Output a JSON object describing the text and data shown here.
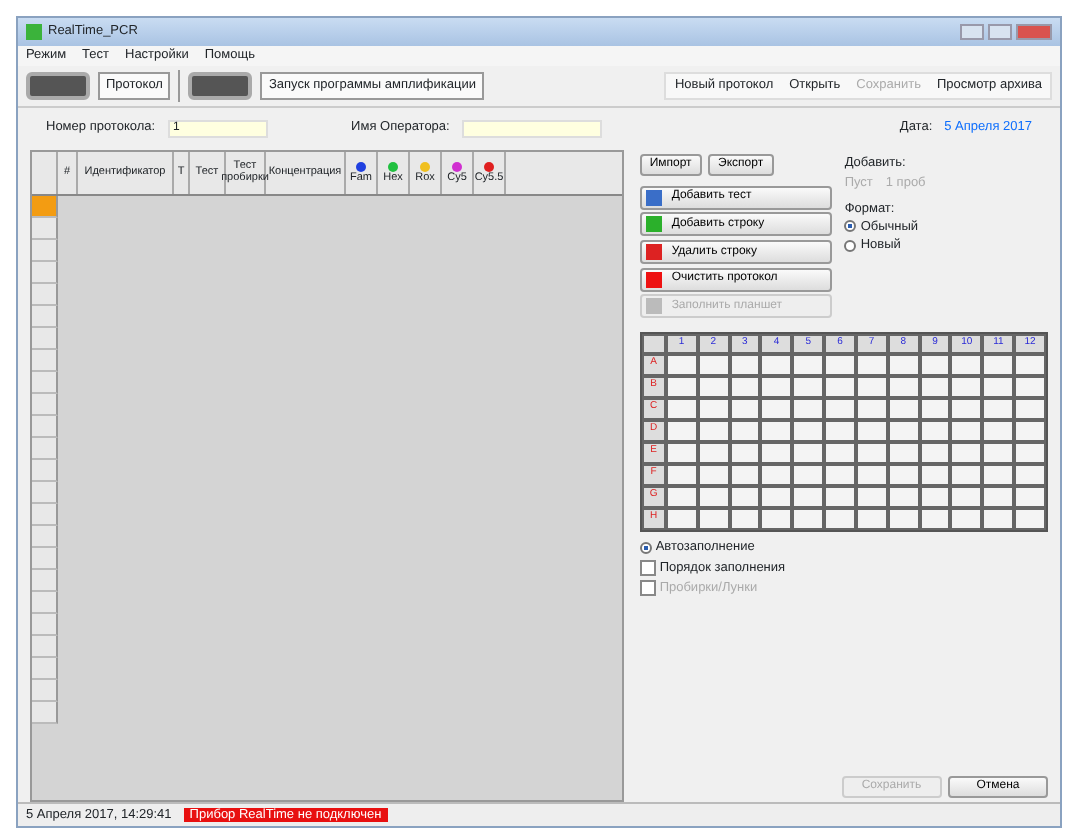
{
  "window": {
    "title": "RealTime_PCR"
  },
  "menu": [
    "Режим",
    "Тест",
    "Настройки",
    "Помощь"
  ],
  "toolbar_left": [
    {
      "label": "Протокол"
    },
    {
      "label": "Запуск программы амплификации"
    }
  ],
  "toolbar_right": [
    {
      "label": "Новый протокол",
      "disabled": false
    },
    {
      "label": "Открыть",
      "disabled": false
    },
    {
      "label": "Сохранить",
      "disabled": true
    },
    {
      "label": "Просмотр архива",
      "disabled": false
    }
  ],
  "protocol": {
    "number_label": "Номер протокола:",
    "number": "1",
    "operator_label": "Имя Оператора:",
    "date_label": "Дата:",
    "date": "5 Апреля 2017"
  },
  "grid": {
    "columns": [
      {
        "label": "#",
        "kind": "text"
      },
      {
        "label": "Идентификатор",
        "kind": "text"
      },
      {
        "label": "Т",
        "kind": "text"
      },
      {
        "label": "Тест",
        "kind": "text"
      },
      {
        "label": "Тест пробирки",
        "kind": "text"
      },
      {
        "label": "Концентрация",
        "kind": "conc"
      },
      {
        "label": "Fam",
        "kind": "dye",
        "color": "#2040e0"
      },
      {
        "label": "Hex",
        "kind": "dye",
        "color": "#20c040"
      },
      {
        "label": "Rox",
        "kind": "dye",
        "color": "#f0c020"
      },
      {
        "label": "Cy5",
        "kind": "dye",
        "color": "#d030d0"
      },
      {
        "label": "Cy5.5",
        "kind": "dye",
        "color": "#e02020"
      }
    ],
    "rows": [
      {
        "selected": true
      },
      {
        "selected": false
      },
      {
        "selected": false
      },
      {
        "selected": false
      },
      {
        "selected": false
      },
      {
        "selected": false
      },
      {
        "selected": false
      },
      {
        "selected": false
      },
      {
        "selected": false
      },
      {
        "selected": false
      },
      {
        "selected": false
      },
      {
        "selected": false
      },
      {
        "selected": false
      },
      {
        "selected": false
      },
      {
        "selected": false
      },
      {
        "selected": false
      },
      {
        "selected": false
      },
      {
        "selected": false
      },
      {
        "selected": false
      },
      {
        "selected": false
      },
      {
        "selected": false
      },
      {
        "selected": false
      },
      {
        "selected": false
      },
      {
        "selected": false
      }
    ]
  },
  "io_buttons": [
    "Импорт",
    "Экспорт"
  ],
  "actions": [
    {
      "label": "Добавить тест",
      "kind": "add-test",
      "disabled": false
    },
    {
      "label": "Добавить строку",
      "kind": "add-row",
      "disabled": false
    },
    {
      "label": "Удалить строку",
      "kind": "remove-row",
      "disabled": false
    },
    {
      "label": "Очистить протокол",
      "kind": "clear",
      "disabled": false
    },
    {
      "label": "Заполнить планшет",
      "kind": "fill",
      "disabled": true
    }
  ],
  "add": {
    "label": "Добавить:",
    "options": [
      "Пуст",
      "1 проб"
    ]
  },
  "format": {
    "label": "Формат:",
    "options": [
      {
        "label": "Обычный",
        "selected": true
      },
      {
        "label": "Новый",
        "selected": false
      }
    ]
  },
  "plate": {
    "columns": [
      "1",
      "2",
      "3",
      "4",
      "5",
      "6",
      "7",
      "8",
      "9",
      "10",
      "11",
      "12"
    ],
    "rows": [
      "A",
      "B",
      "C",
      "D",
      "E",
      "F",
      "G",
      "H"
    ]
  },
  "options": [
    {
      "label": "Автозаполнение",
      "kind": "radio",
      "checked": true,
      "disabled": false
    },
    {
      "label": "Порядок заполнения",
      "kind": "order",
      "checked": false,
      "disabled": false
    },
    {
      "label": "Пробирки/Лунки",
      "kind": "check",
      "checked": false,
      "disabled": true
    }
  ],
  "footer_buttons": [
    {
      "label": "Сохранить",
      "disabled": true
    },
    {
      "label": "Отмена",
      "disabled": false
    }
  ],
  "status_bar": [
    {
      "text": "5 Апреля 2017, 14:29:41",
      "kind": "plain"
    },
    {
      "text": "Прибор RealTime не подключен",
      "kind": "alert"
    }
  ]
}
